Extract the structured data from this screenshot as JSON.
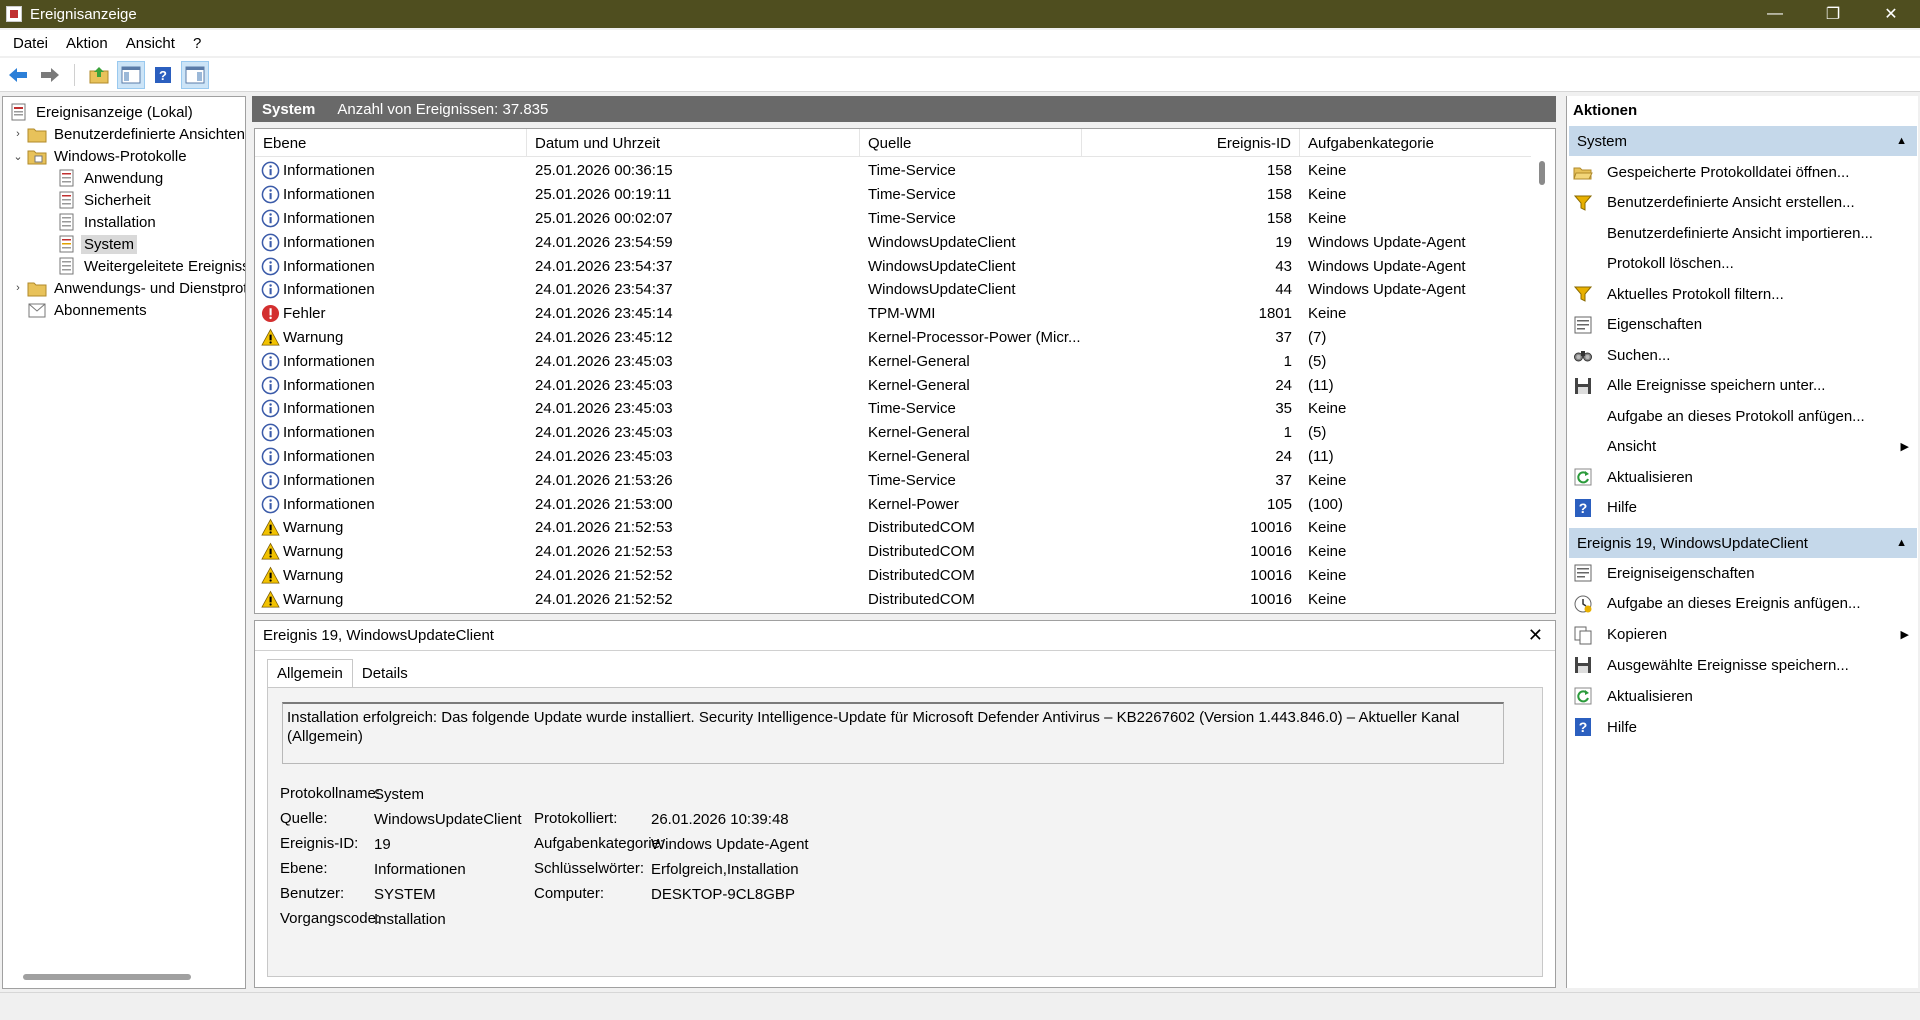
{
  "window": {
    "title": "Ereignisanzeige",
    "controls": {
      "minimize": "—",
      "restore": "❐",
      "close": "✕"
    }
  },
  "menu": [
    "Datei",
    "Aktion",
    "Ansicht",
    "?"
  ],
  "toolbar": {
    "buttons": [
      "back-arrow-icon",
      "forward-arrow-icon",
      "folder-up-icon",
      "show-hide-tree-icon",
      "help-icon",
      "show-hide-action-icon"
    ]
  },
  "tree": {
    "root": "Ereignisanzeige (Lokal)",
    "custom_views": "Benutzerdefinierte Ansichten",
    "windows_logs": "Windows-Protokolle",
    "logs": [
      "Anwendung",
      "Sicherheit",
      "Installation",
      "System",
      "Weitergeleitete Ereignisse"
    ],
    "app_services": "Anwendungs- und Dienstprotokolle",
    "subscriptions": "Abonnements"
  },
  "center": {
    "title": "System",
    "count_text": "Anzahl von Ereignissen: 37.835"
  },
  "list": {
    "columns": [
      "Ebene",
      "Datum und Uhrzeit",
      "Quelle",
      "Ereignis-ID",
      "Aufgabenkategorie"
    ],
    "rows": [
      {
        "level": "Informationen",
        "type": "info",
        "date": "25.01.2026 00:36:15",
        "source": "Time-Service",
        "id": "158",
        "category": "Keine"
      },
      {
        "level": "Informationen",
        "type": "info",
        "date": "25.01.2026 00:19:11",
        "source": "Time-Service",
        "id": "158",
        "category": "Keine"
      },
      {
        "level": "Informationen",
        "type": "info",
        "date": "25.01.2026 00:02:07",
        "source": "Time-Service",
        "id": "158",
        "category": "Keine"
      },
      {
        "level": "Informationen",
        "type": "info",
        "date": "24.01.2026 23:54:59",
        "source": "WindowsUpdateClient",
        "id": "19",
        "category": "Windows Update-Agent"
      },
      {
        "level": "Informationen",
        "type": "info",
        "date": "24.01.2026 23:54:37",
        "source": "WindowsUpdateClient",
        "id": "43",
        "category": "Windows Update-Agent"
      },
      {
        "level": "Informationen",
        "type": "info",
        "date": "24.01.2026 23:54:37",
        "source": "WindowsUpdateClient",
        "id": "44",
        "category": "Windows Update-Agent"
      },
      {
        "level": "Fehler",
        "type": "error",
        "date": "24.01.2026 23:45:14",
        "source": "TPM-WMI",
        "id": "1801",
        "category": "Keine"
      },
      {
        "level": "Warnung",
        "type": "warn",
        "date": "24.01.2026 23:45:12",
        "source": "Kernel-Processor-Power (Micr...",
        "id": "37",
        "category": "(7)"
      },
      {
        "level": "Informationen",
        "type": "info",
        "date": "24.01.2026 23:45:03",
        "source": "Kernel-General",
        "id": "1",
        "category": "(5)"
      },
      {
        "level": "Informationen",
        "type": "info",
        "date": "24.01.2026 23:45:03",
        "source": "Kernel-General",
        "id": "24",
        "category": "(11)"
      },
      {
        "level": "Informationen",
        "type": "info",
        "date": "24.01.2026 23:45:03",
        "source": "Time-Service",
        "id": "35",
        "category": "Keine"
      },
      {
        "level": "Informationen",
        "type": "info",
        "date": "24.01.2026 23:45:03",
        "source": "Kernel-General",
        "id": "1",
        "category": "(5)"
      },
      {
        "level": "Informationen",
        "type": "info",
        "date": "24.01.2026 23:45:03",
        "source": "Kernel-General",
        "id": "24",
        "category": "(11)"
      },
      {
        "level": "Informationen",
        "type": "info",
        "date": "24.01.2026 21:53:26",
        "source": "Time-Service",
        "id": "37",
        "category": "Keine"
      },
      {
        "level": "Informationen",
        "type": "info",
        "date": "24.01.2026 21:53:00",
        "source": "Kernel-Power",
        "id": "105",
        "category": "(100)"
      },
      {
        "level": "Warnung",
        "type": "warn",
        "date": "24.01.2026 21:52:53",
        "source": "DistributedCOM",
        "id": "10016",
        "category": "Keine"
      },
      {
        "level": "Warnung",
        "type": "warn",
        "date": "24.01.2026 21:52:53",
        "source": "DistributedCOM",
        "id": "10016",
        "category": "Keine"
      },
      {
        "level": "Warnung",
        "type": "warn",
        "date": "24.01.2026 21:52:52",
        "source": "DistributedCOM",
        "id": "10016",
        "category": "Keine"
      },
      {
        "level": "Warnung",
        "type": "warn",
        "date": "24.01.2026 21:52:52",
        "source": "DistributedCOM",
        "id": "10016",
        "category": "Keine"
      }
    ]
  },
  "detail": {
    "title": "Ereignis 19, WindowsUpdateClient",
    "tabs": [
      "Allgemein",
      "Details"
    ],
    "message": "Installation erfolgreich: Das folgende Update wurde installiert. Security Intelligence-Update für Microsoft Defender Antivirus – KB2267602 (Version 1.443.846.0) – Aktueller Kanal (Allgemein)",
    "labels": {
      "log_name": "Protokollname:",
      "source": "Quelle:",
      "event_id": "Ereignis-ID:",
      "level": "Ebene:",
      "user": "Benutzer:",
      "opcode": "Vorgangscode:",
      "logged": "Protokolliert:",
      "task_category": "Aufgabenkategorie:",
      "keywords": "Schlüsselwörter:",
      "computer": "Computer:"
    },
    "values": {
      "log_name": "System",
      "source": "WindowsUpdateClient",
      "event_id": "19",
      "level": "Informationen",
      "user": "SYSTEM",
      "opcode": "Installation",
      "logged": "26.01.2026 10:39:48",
      "task_category": "Windows Update-Agent",
      "keywords": "Erfolgreich,Installation",
      "computer": "DESKTOP-9CL8GBP"
    }
  },
  "actions": {
    "title": "Aktionen",
    "section1": {
      "title": "System",
      "items": [
        {
          "label": "Gespeicherte Protokolldatei öffnen...",
          "icon": "open-folder-icon"
        },
        {
          "label": "Benutzerdefinierte Ansicht erstellen...",
          "icon": "filter-icon"
        },
        {
          "label": "Benutzerdefinierte Ansicht importieren...",
          "icon": ""
        },
        {
          "label": "Protokoll löschen...",
          "icon": ""
        },
        {
          "label": "Aktuelles Protokoll filtern...",
          "icon": "filter-icon"
        },
        {
          "label": "Eigenschaften",
          "icon": "properties-icon"
        },
        {
          "label": "Suchen...",
          "icon": "binoculars-icon"
        },
        {
          "label": "Alle Ereignisse speichern unter...",
          "icon": "save-icon"
        },
        {
          "label": "Aufgabe an dieses Protokoll anfügen...",
          "icon": ""
        },
        {
          "label": "Ansicht",
          "icon": "",
          "submenu": true
        },
        {
          "label": "Aktualisieren",
          "icon": "refresh-icon"
        },
        {
          "label": "Hilfe",
          "icon": "help-icon"
        }
      ]
    },
    "section2": {
      "title": "Ereignis 19, WindowsUpdateClient",
      "items": [
        {
          "label": "Ereigniseigenschaften",
          "icon": "properties-icon"
        },
        {
          "label": "Aufgabe an dieses Ereignis anfügen...",
          "icon": "task-clock-icon"
        },
        {
          "label": "Kopieren",
          "icon": "copy-icon",
          "submenu": true
        },
        {
          "label": "Ausgewählte Ereignisse speichern...",
          "icon": "save-icon"
        },
        {
          "label": "Aktualisieren",
          "icon": "refresh-icon"
        },
        {
          "label": "Hilfe",
          "icon": "help-icon"
        }
      ]
    }
  },
  "colors": {
    "titlebar": "#4f4e1f",
    "center_header": "#696969",
    "actions_section": "#c5d8ea",
    "info_icon": "#3b5ba9",
    "error_icon": "#d32f2f",
    "warning_icon": "#f2c200"
  }
}
